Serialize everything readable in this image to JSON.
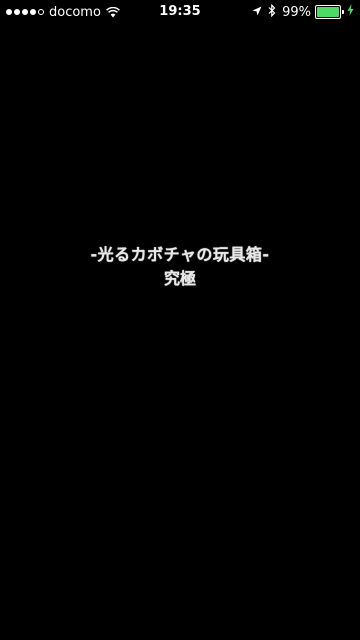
{
  "status_bar": {
    "signal_filled": 4,
    "signal_total": 5,
    "carrier": "docomo",
    "time": "19:35",
    "battery_percent": "99%",
    "battery_level": 0.99,
    "battery_color": "#4cd964",
    "icons": [
      "wifi-icon",
      "location-icon",
      "bluetooth-icon",
      "battery-icon",
      "charging-icon"
    ]
  },
  "screen": {
    "background": "#000000",
    "title": "-光るカボチャの玩具箱-",
    "subtitle": "究極"
  }
}
